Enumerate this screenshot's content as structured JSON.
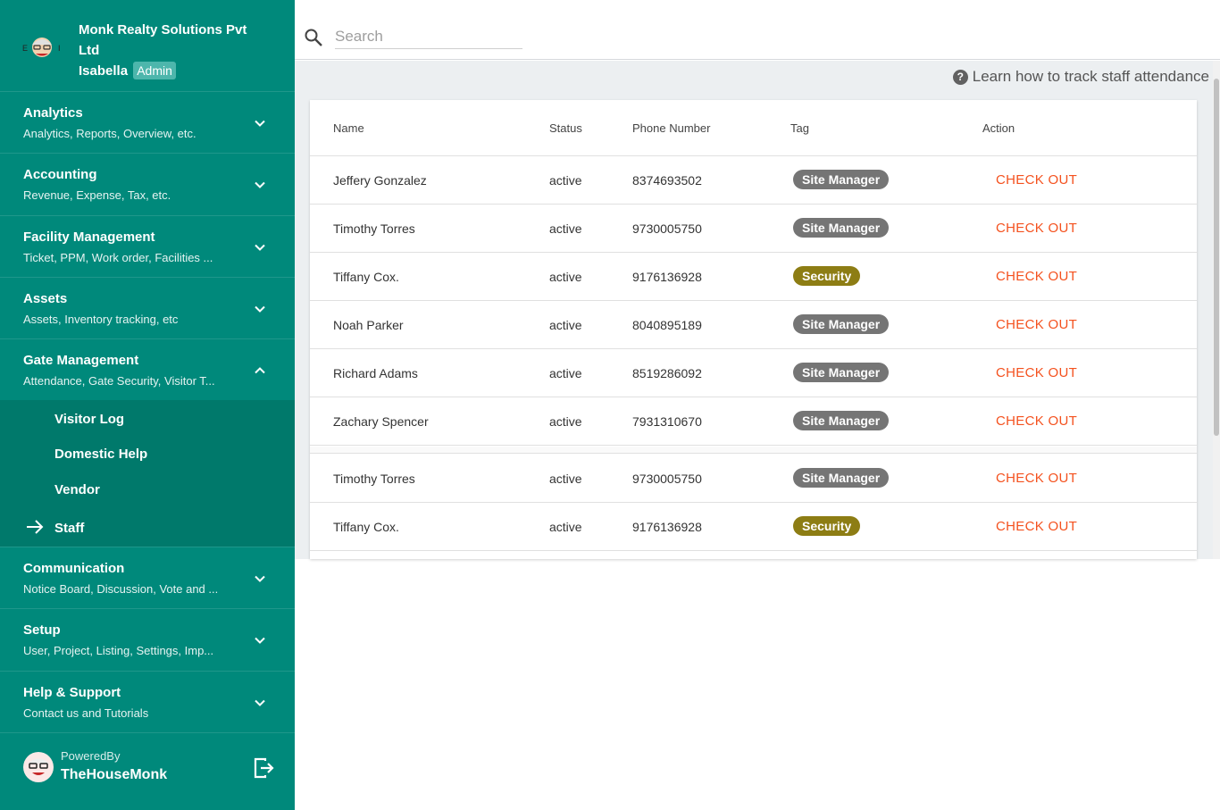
{
  "org": {
    "name": "Monk Realty Solutions Pvt Ltd",
    "user": "Isabella",
    "role": "Admin"
  },
  "nav": {
    "items": [
      {
        "title": "Analytics",
        "subtitle": "Analytics, Reports, Overview, etc."
      },
      {
        "title": "Accounting",
        "subtitle": "Revenue, Expense, Tax, etc."
      },
      {
        "title": "Facility Management",
        "subtitle": "Ticket, PPM, Work order, Facilities ..."
      },
      {
        "title": "Assets",
        "subtitle": "Assets, Inventory tracking, etc"
      },
      {
        "title": "Gate Management",
        "subtitle": "Attendance, Gate Security, Visitor T..."
      },
      {
        "title": "Communication",
        "subtitle": "Notice Board, Discussion, Vote and ..."
      },
      {
        "title": "Setup",
        "subtitle": "User, Project, Listing, Settings, Imp..."
      },
      {
        "title": "Help & Support",
        "subtitle": "Contact us and Tutorials"
      }
    ],
    "gate_submenu": [
      "Visitor Log",
      "Domestic Help",
      "Vendor",
      "Staff"
    ],
    "active_submenu": "Staff"
  },
  "footer": {
    "powered_by": "PoweredBy",
    "brand": "TheHouseMonk"
  },
  "search": {
    "placeholder": "Search"
  },
  "help_link": "Learn how to track staff attendance",
  "table": {
    "headers": [
      "Name",
      "Status",
      "Phone Number",
      "Tag",
      "Action"
    ],
    "rows": [
      {
        "name": "Jeffery Gonzalez",
        "status": "active",
        "phone": "8374693502",
        "tag": "Site Manager",
        "action": "CHECK OUT"
      },
      {
        "name": "Timothy Torres",
        "status": "active",
        "phone": "9730005750",
        "tag": "Site Manager",
        "action": "CHECK OUT"
      },
      {
        "name": "Tiffany Cox.",
        "status": "active",
        "phone": "9176136928",
        "tag": "Security",
        "action": "CHECK OUT"
      },
      {
        "name": "Noah Parker",
        "status": "active",
        "phone": "8040895189",
        "tag": "Site Manager",
        "action": "CHECK OUT"
      },
      {
        "name": "Richard Adams",
        "status": "active",
        "phone": "8519286092",
        "tag": "Site Manager",
        "action": "CHECK OUT"
      },
      {
        "name": "Zachary Spencer",
        "status": "active",
        "phone": "7931310670",
        "tag": "Site Manager",
        "action": "CHECK OUT"
      },
      {
        "name": "Timothy Torres",
        "status": "active",
        "phone": "9730005750",
        "tag": "Site Manager",
        "action": "CHECK OUT"
      },
      {
        "name": "Tiffany Cox.",
        "status": "active",
        "phone": "9176136928",
        "tag": "Security",
        "action": "CHECK OUT"
      }
    ]
  },
  "colors": {
    "sidebar": "#00897b",
    "submenu": "#00796b",
    "action": "#f4511e",
    "tag_site_manager": "#757575",
    "tag_security": "#8d7d14"
  }
}
